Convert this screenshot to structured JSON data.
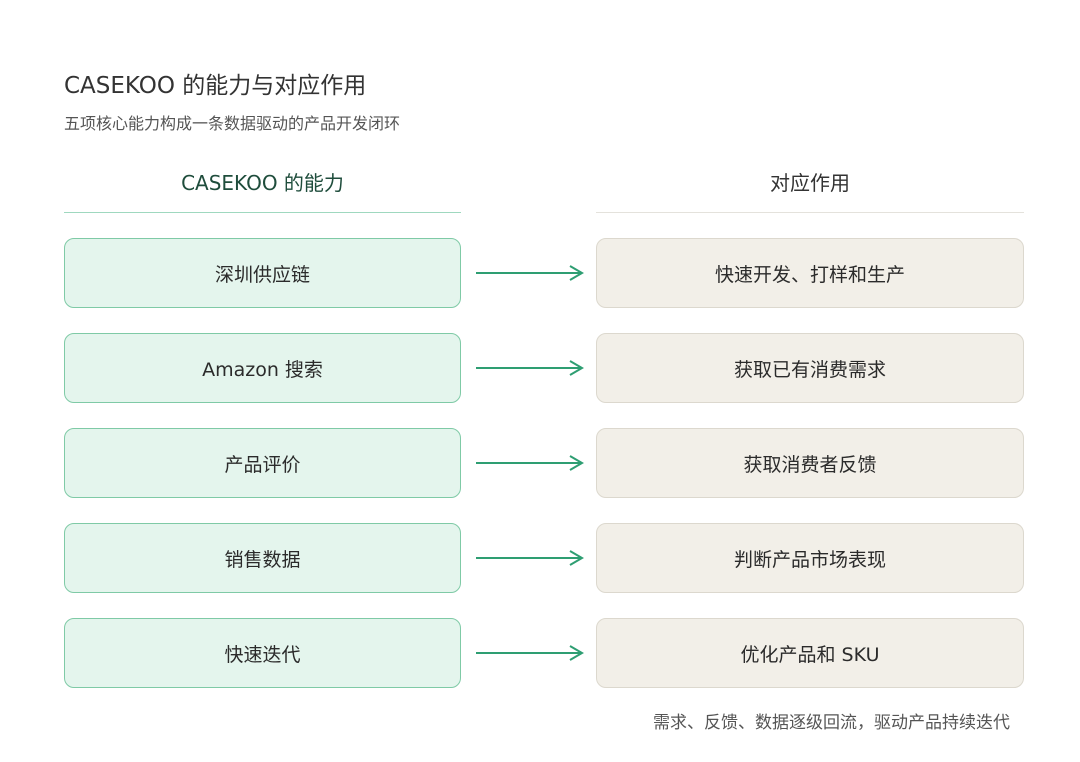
{
  "title": "CASEKOO 的能力与对应作用",
  "subtitle": "五项核心能力构成一条数据驱动的产品开发闭环",
  "columns": {
    "left_header": "CASEKOO 的能力",
    "right_header": "对应作用"
  },
  "rows": [
    {
      "capability": "深圳供应链",
      "effect": "快速开发、打样和生产"
    },
    {
      "capability": "Amazon 搜索",
      "effect": "获取已有消费需求"
    },
    {
      "capability": "产品评价",
      "effect": "获取消费者反馈"
    },
    {
      "capability": "销售数据",
      "effect": "判断产品市场表现"
    },
    {
      "capability": "快速迭代",
      "effect": "优化产品和 SKU"
    }
  ],
  "footnote": "需求、反馈、数据逐级回流，驱动产品持续迭代",
  "colors": {
    "capability_fill": "#e4f5ed",
    "capability_border": "#7fcaa6",
    "effect_fill": "#f2efe8",
    "effect_border": "#dcd8ce",
    "arrow": "#2e9e72"
  },
  "icons": {
    "connector": "right-arrow-icon"
  }
}
